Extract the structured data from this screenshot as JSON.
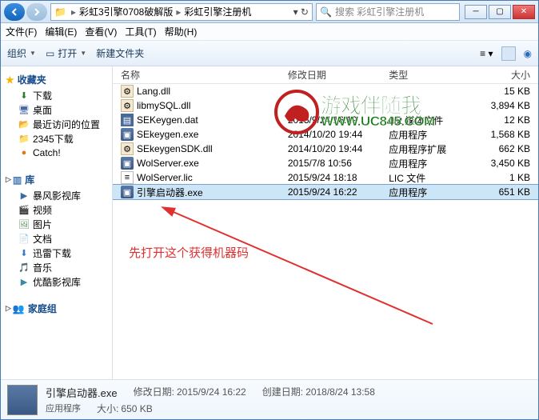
{
  "breadcrumb": [
    "彩虹3引擎0708破解版",
    "彩虹引擎注册机"
  ],
  "search_placeholder": "搜索 彩虹引擎注册机",
  "menu": {
    "file": "文件(F)",
    "edit": "编辑(E)",
    "view": "查看(V)",
    "tools": "工具(T)",
    "help": "帮助(H)"
  },
  "toolbar": {
    "organize": "组织",
    "open": "打开",
    "newfolder": "新建文件夹"
  },
  "sidebar": {
    "favorites": {
      "label": "收藏夹",
      "items": [
        {
          "label": "下载",
          "icon": "⬇",
          "color": "#2a7a2a"
        },
        {
          "label": "桌面",
          "icon": "🖥",
          "color": "#4a6aa5"
        },
        {
          "label": "最近访问的位置",
          "icon": "📂",
          "color": "#c8a040"
        },
        {
          "label": "2345下载",
          "icon": "📁",
          "color": "#c8a040"
        },
        {
          "label": "Catch!",
          "icon": "●",
          "color": "#e0781a"
        }
      ]
    },
    "libraries": {
      "label": "库",
      "items": [
        {
          "label": "暴风影视库",
          "icon": "▶",
          "color": "#3a6aa5"
        },
        {
          "label": "视频",
          "icon": "🎬",
          "color": "#5a7aa5"
        },
        {
          "label": "图片",
          "icon": "🖼",
          "color": "#5a8a5a"
        },
        {
          "label": "文档",
          "icon": "📄",
          "color": "#8a6a4a"
        },
        {
          "label": "迅雷下载",
          "icon": "⬇",
          "color": "#3a7ac5"
        },
        {
          "label": "音乐",
          "icon": "🎵",
          "color": "#a56a3a"
        },
        {
          "label": "优酷影视库",
          "icon": "▶",
          "color": "#3a8aa5"
        }
      ]
    },
    "homegroup": {
      "label": "家庭组"
    }
  },
  "columns": {
    "name": "名称",
    "date": "修改日期",
    "type": "类型",
    "size": "大小"
  },
  "files": [
    {
      "name": "Lang.dll",
      "date": "",
      "type": "",
      "size": "15 KB",
      "ico": "dll"
    },
    {
      "name": "libmySQL.dll",
      "date": "",
      "type": "",
      "size": "3,894 KB",
      "ico": "dll"
    },
    {
      "name": "SEKeygen.dat",
      "date": "2015/9/24 16:19",
      "type": "dat 媒体文件",
      "size": "12 KB",
      "ico": "dat"
    },
    {
      "name": "SEkeygen.exe",
      "date": "2014/10/20 19:44",
      "type": "应用程序",
      "size": "1,568 KB",
      "ico": "exe"
    },
    {
      "name": "SEkeygenSDK.dll",
      "date": "2014/10/20 19:44",
      "type": "应用程序扩展",
      "size": "662 KB",
      "ico": "dll"
    },
    {
      "name": "WolServer.exe",
      "date": "2015/7/8 10:56",
      "type": "应用程序",
      "size": "3,450 KB",
      "ico": "exe"
    },
    {
      "name": "WolServer.lic",
      "date": "2015/9/24 18:18",
      "type": "LIC 文件",
      "size": "1 KB",
      "ico": "lic"
    },
    {
      "name": "引擎启动器.exe",
      "date": "2015/9/24 16:22",
      "type": "应用程序",
      "size": "651 KB",
      "ico": "exe",
      "selected": true
    }
  ],
  "annotation": "先打开这个获得机器码",
  "watermark": {
    "line1": "游戏伴随我",
    "line2": "WWW.UC845.COM"
  },
  "details": {
    "name": "引擎启动器.exe",
    "type": "应用程序",
    "mod_label": "修改日期:",
    "mod": "2015/9/24 16:22",
    "size_label": "大小:",
    "size": "650 KB",
    "created_label": "创建日期:",
    "created": "2018/8/24 13:58"
  }
}
